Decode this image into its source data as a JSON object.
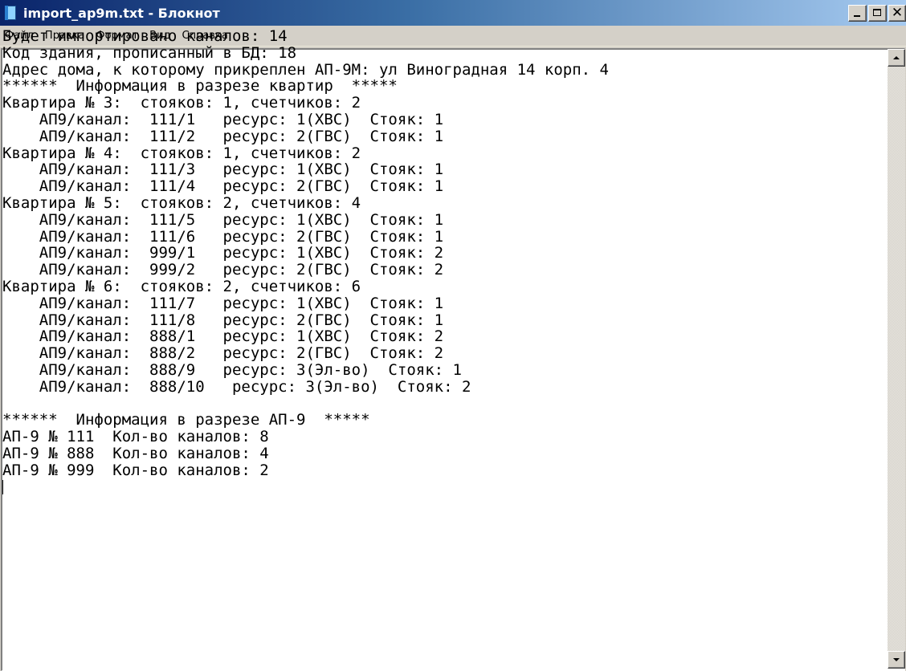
{
  "window": {
    "title": "import_ap9m.txt - Блокнот",
    "minimize_icon": "minimize-icon",
    "maximize_icon": "maximize-icon",
    "close_icon": "close-icon",
    "close_glyph": "✕"
  },
  "menu": {
    "items": [
      {
        "label": "Файл"
      },
      {
        "label": "Правка"
      },
      {
        "label": "Формат"
      },
      {
        "label": "Вид"
      },
      {
        "label": "Справка"
      }
    ]
  },
  "document": {
    "lines": [
      "Будет импортировано каналов: 14",
      "Код здания, прописанный в БД: 18",
      "Адрес дома, к которому прикреплен АП-9М: ул Виноградная 14 корп. 4",
      "******  Информация в разрезе квартир  *****",
      "Квартира № 3:  стояков: 1, счетчиков: 2",
      "    АП9/канал:  111/1   ресурс: 1(ХВС)  Стояк: 1",
      "    АП9/канал:  111/2   ресурс: 2(ГВС)  Стояк: 1",
      "Квартира № 4:  стояков: 1, счетчиков: 2",
      "    АП9/канал:  111/3   ресурс: 1(ХВС)  Стояк: 1",
      "    АП9/канал:  111/4   ресурс: 2(ГВС)  Стояк: 1",
      "Квартира № 5:  стояков: 2, счетчиков: 4",
      "    АП9/канал:  111/5   ресурс: 1(ХВС)  Стояк: 1",
      "    АП9/канал:  111/6   ресурс: 2(ГВС)  Стояк: 1",
      "    АП9/канал:  999/1   ресурс: 1(ХВС)  Стояк: 2",
      "    АП9/канал:  999/2   ресурс: 2(ГВС)  Стояк: 2",
      "Квартира № 6:  стояков: 2, счетчиков: 6",
      "    АП9/канал:  111/7   ресурс: 1(ХВС)  Стояк: 1",
      "    АП9/канал:  111/8   ресурс: 2(ГВС)  Стояк: 1",
      "    АП9/канал:  888/1   ресурс: 1(ХВС)  Стояк: 2",
      "    АП9/канал:  888/2   ресурс: 2(ГВС)  Стояк: 2",
      "    АП9/канал:  888/9   ресурс: 3(Эл-во)  Стояк: 1",
      "    АП9/канал:  888/10   ресурс: 3(Эл-во)  Стояк: 2",
      "",
      "******  Информация в разрезе АП-9  *****",
      "АП-9 № 111  Кол-во каналов: 8",
      "АП-9 № 888  Кол-во каналов: 4",
      "АП-9 № 999  Кол-во каналов: 2",
      ""
    ]
  },
  "scrollbar": {
    "up_icon": "scroll-up-arrow-icon",
    "down_icon": "scroll-down-arrow-icon"
  }
}
